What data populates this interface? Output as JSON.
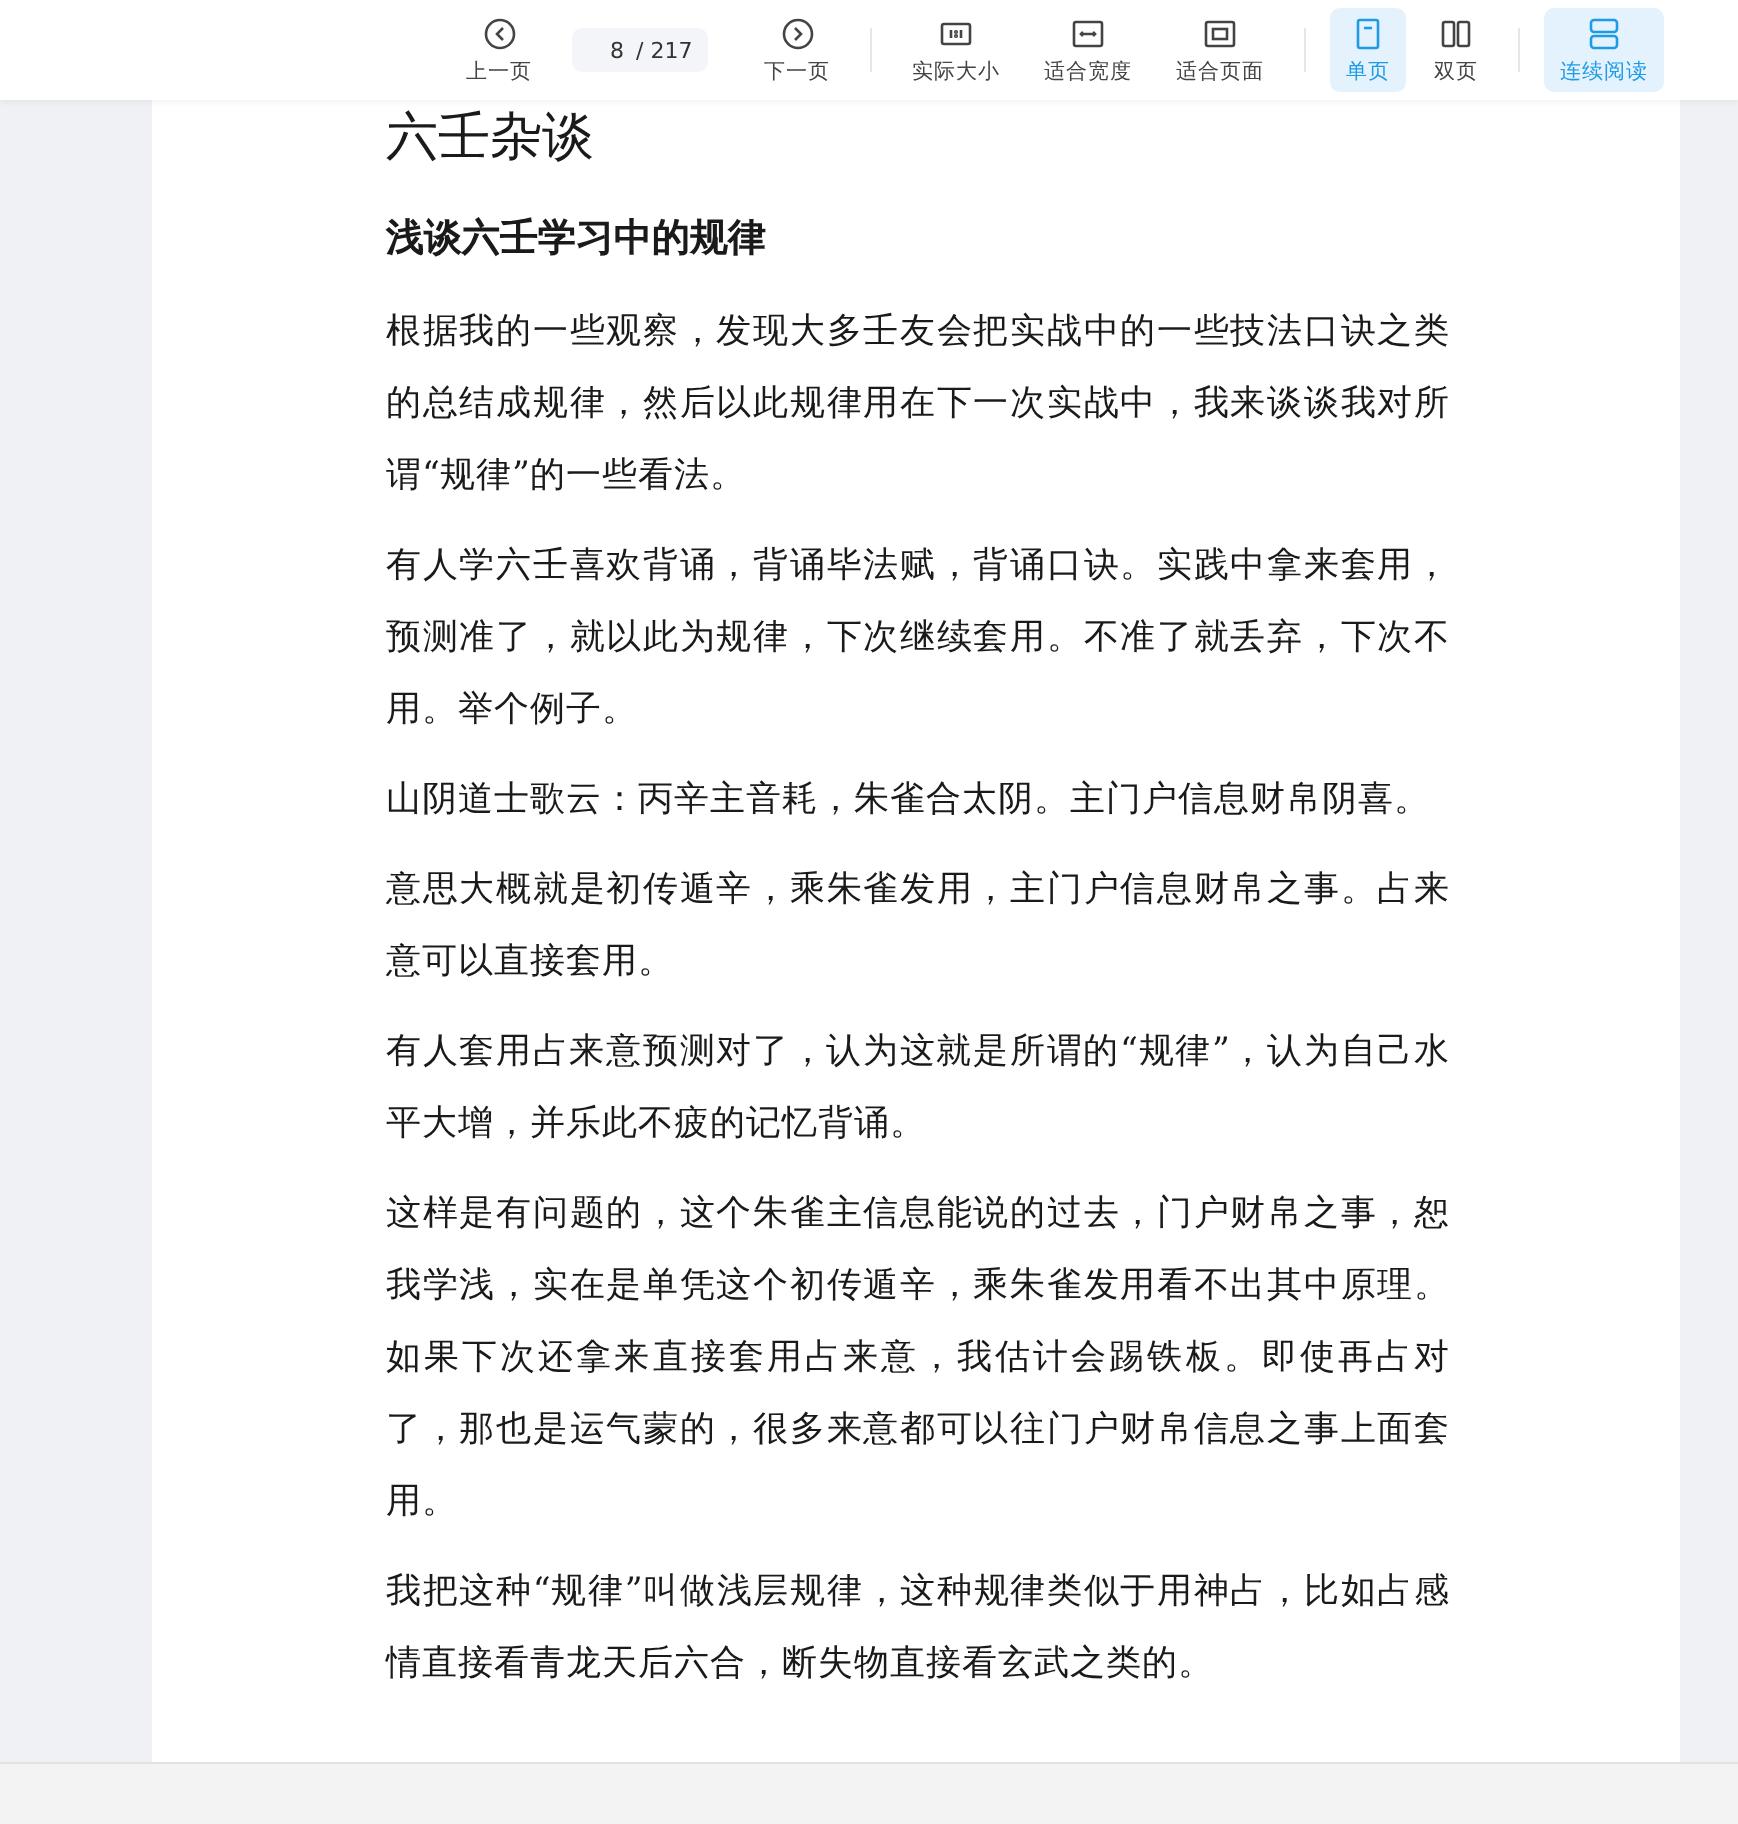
{
  "toolbar": {
    "prev": {
      "label": "上一页"
    },
    "page_field": {
      "value": "8",
      "total": "/ 217"
    },
    "next": {
      "label": "下一页"
    },
    "fit_modes": [
      {
        "kind": "actual",
        "label": "实际大小"
      },
      {
        "kind": "width",
        "label": "适合宽度"
      },
      {
        "kind": "page",
        "label": "适合页面"
      }
    ],
    "view_modes": [
      {
        "kind": "single",
        "label": "单页",
        "selected": true
      },
      {
        "kind": "double",
        "label": "双页",
        "selected": false
      }
    ],
    "continuous": {
      "label": "连续阅读",
      "on": true
    }
  },
  "document": {
    "title": "六壬杂谈",
    "heading": "浅谈六壬学习中的规律",
    "paragraphs": [
      "根据我的一些观察，发现大多壬友会把实战中的一些技法口诀之类的总结成规律，然后以此规律用在下一次实战中，我来谈谈我对所谓“规律”的一些看法。",
      "有人学六壬喜欢背诵，背诵毕法赋，背诵口诀。实践中拿来套用，预测准了，就以此为规律，下次继续套用。不准了就丢弃，下次不用。举个例子。",
      "山阴道士歌云：丙辛主音耗，朱雀合太阴。主门户信息财帛阴喜。",
      "意思大概就是初传遁辛，乘朱雀发用，主门户信息财帛之事。占来意可以直接套用。",
      "有人套用占来意预测对了，认为这就是所谓的“规律”，认为自己水平大增，并乐此不疲的记忆背诵。",
      "这样是有问题的，这个朱雀主信息能说的过去，门户财帛之事，恕我学浅，实在是单凭这个初传遁辛，乘朱雀发用看不出其中原理。如果下次还拿来直接套用占来意，我估计会踢铁板。即使再占对了，那也是运气蒙的，很多来意都可以往门户财帛信息之事上面套用。",
      "我把这种“规律”叫做浅层规律，这种规律类似于用神占，比如占感情直接看青龙天后六合，断失物直接看玄武之类的。"
    ]
  }
}
